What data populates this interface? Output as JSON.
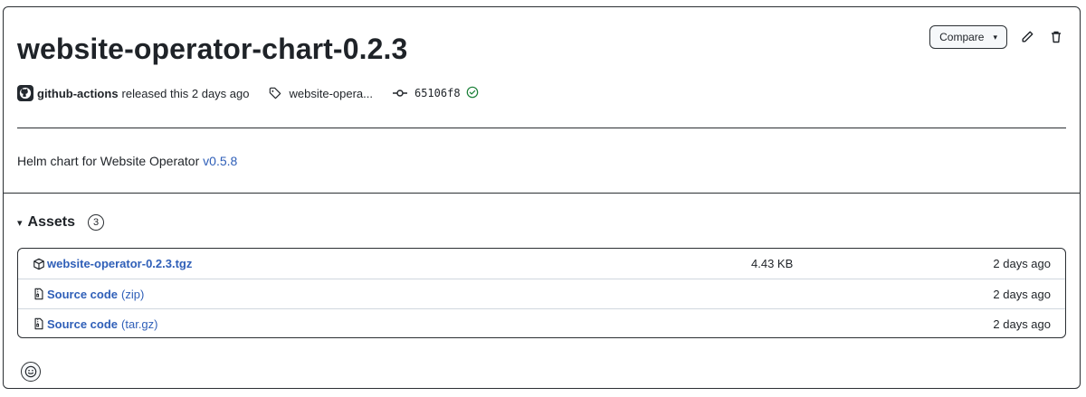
{
  "release": {
    "title": "website-operator-chart-0.2.3",
    "author": "github-actions",
    "released_text": "released this 2 days ago",
    "tag": "website-opera...",
    "commit": "65106f8",
    "description_text": "Helm chart for Website Operator ",
    "description_link": "v0.5.8"
  },
  "actions": {
    "compare_label": "Compare",
    "compare_caret": "▾"
  },
  "assets": {
    "heading": "Assets",
    "toggle": "▾",
    "count": "3",
    "items": [
      {
        "name": "website-operator-0.2.3.tgz",
        "ext": "",
        "size": "4.43 KB",
        "date": "2 days ago",
        "icon": "package-icon"
      },
      {
        "name": "Source code",
        "ext": "(zip)",
        "size": "",
        "date": "2 days ago",
        "icon": "file-zip-icon"
      },
      {
        "name": "Source code",
        "ext": "(tar.gz)",
        "size": "",
        "date": "2 days ago",
        "icon": "file-zip-icon"
      }
    ]
  },
  "colors": {
    "link": "#2f5fb8",
    "success": "#1a7f37",
    "border": "#2b2f33"
  }
}
